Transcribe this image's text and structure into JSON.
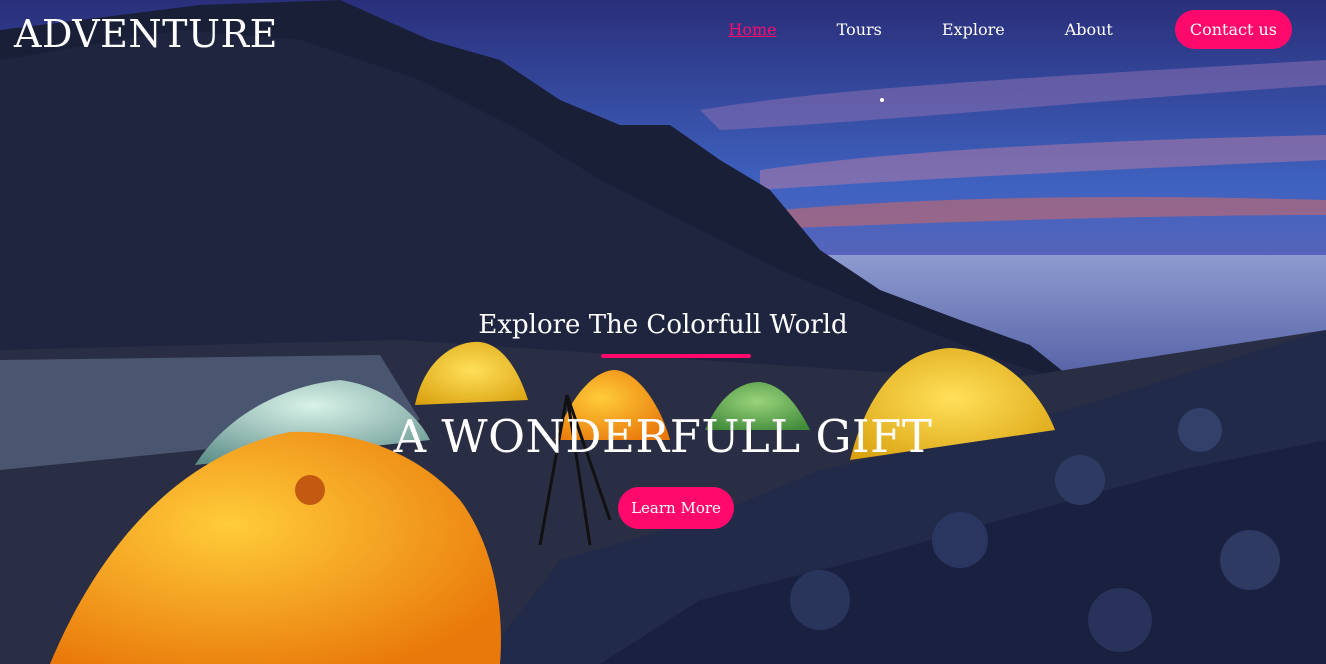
{
  "brand": {
    "name": "ADVENTURE"
  },
  "nav": {
    "items": [
      {
        "label": "Home",
        "active": true
      },
      {
        "label": "Tours"
      },
      {
        "label": "Explore"
      },
      {
        "label": "About"
      }
    ],
    "contact_label": "Contact us"
  },
  "hero": {
    "tagline": "Explore The Colorfull World",
    "headline": "A WONDERFULL GIFT",
    "cta_label": "Learn More"
  },
  "colors": {
    "accent": "#ff0a6c",
    "text": "#ffffff"
  }
}
